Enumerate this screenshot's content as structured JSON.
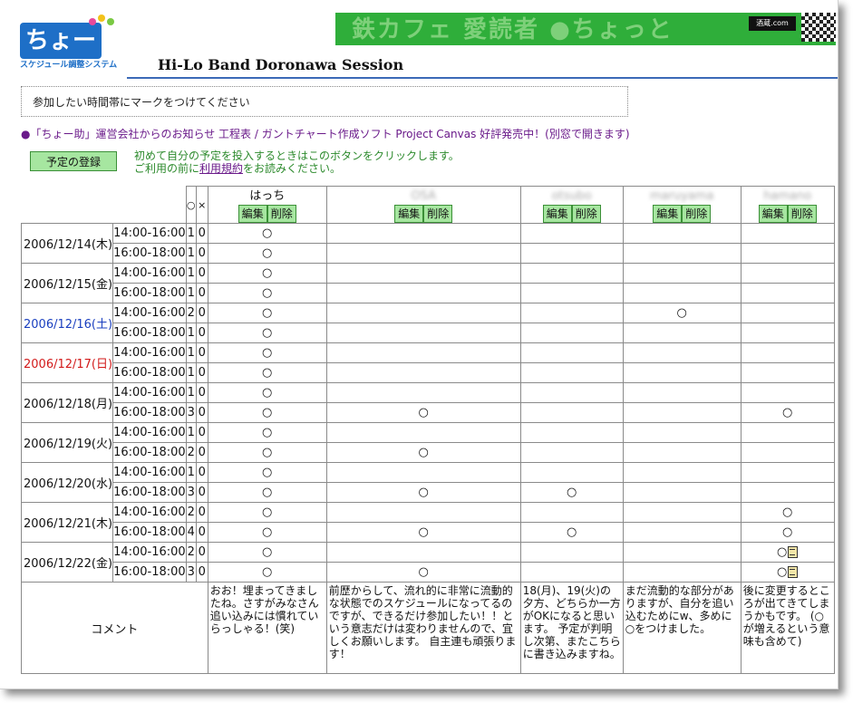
{
  "logo": {
    "main": "ちょー助",
    "sub": "スケジュール調整システム"
  },
  "banner": {
    "text": "鉄カフェ 愛読者 ●ちょっと",
    "badge": "酒蔵.com"
  },
  "title": "Hi-Lo Band Doronawa Session",
  "notice": "参加したい時間帯にマークをつけてください",
  "news": "●「ちょー助」運営会社からのお知らせ 工程表 / ガントチャート作成ソフト Project Canvas 好評発売中！(別窓で開きます)",
  "register": {
    "button": "予定の登録",
    "info_line1": "初めて自分の予定を投入するときはこのボタンをクリックします。",
    "info_line2_pre": "ご利用の前に",
    "info_link": "利用規約",
    "info_line2_post": "をお読みください。"
  },
  "table": {
    "hdr_o": "○",
    "hdr_x": "×",
    "edit_label": "編集",
    "delete_label": "削除",
    "members": [
      "はっち",
      "OSA",
      "otsubo",
      "maruyama",
      "hamano"
    ],
    "comment_label": "コメント",
    "rows": [
      {
        "date": "2006/12/14(木)",
        "day": "wk",
        "time": "14:00-16:00",
        "o": "1",
        "x": "0",
        "marks": [
          "○",
          "",
          "",
          "",
          ""
        ]
      },
      {
        "date": "",
        "day": "wk",
        "time": "16:00-18:00",
        "o": "1",
        "x": "0",
        "marks": [
          "○",
          "",
          "",
          "",
          ""
        ]
      },
      {
        "date": "2006/12/15(金)",
        "day": "wk",
        "time": "14:00-16:00",
        "o": "1",
        "x": "0",
        "marks": [
          "○",
          "",
          "",
          "",
          ""
        ]
      },
      {
        "date": "",
        "day": "wk",
        "time": "16:00-18:00",
        "o": "1",
        "x": "0",
        "marks": [
          "○",
          "",
          "",
          "",
          ""
        ]
      },
      {
        "date": "2006/12/16(土)",
        "day": "sat",
        "time": "14:00-16:00",
        "o": "2",
        "x": "0",
        "marks": [
          "○",
          "",
          "",
          "○",
          ""
        ]
      },
      {
        "date": "",
        "day": "wk",
        "time": "16:00-18:00",
        "o": "1",
        "x": "0",
        "marks": [
          "○",
          "",
          "",
          "",
          ""
        ]
      },
      {
        "date": "2006/12/17(日)",
        "day": "sun",
        "time": "14:00-16:00",
        "o": "1",
        "x": "0",
        "marks": [
          "○",
          "",
          "",
          "",
          ""
        ]
      },
      {
        "date": "",
        "day": "wk",
        "time": "16:00-18:00",
        "o": "1",
        "x": "0",
        "marks": [
          "○",
          "",
          "",
          "",
          ""
        ]
      },
      {
        "date": "2006/12/18(月)",
        "day": "wk",
        "time": "14:00-16:00",
        "o": "1",
        "x": "0",
        "marks": [
          "○",
          "",
          "",
          "",
          ""
        ]
      },
      {
        "date": "",
        "day": "wk",
        "time": "16:00-18:00",
        "o": "3",
        "x": "0",
        "marks": [
          "○",
          "○",
          "",
          "",
          "○"
        ]
      },
      {
        "date": "2006/12/19(火)",
        "day": "wk",
        "time": "14:00-16:00",
        "o": "1",
        "x": "0",
        "marks": [
          "○",
          "",
          "",
          "",
          ""
        ]
      },
      {
        "date": "",
        "day": "wk",
        "time": "16:00-18:00",
        "o": "2",
        "x": "0",
        "marks": [
          "○",
          "○",
          "",
          "",
          ""
        ]
      },
      {
        "date": "2006/12/20(水)",
        "day": "wk",
        "time": "14:00-16:00",
        "o": "1",
        "x": "0",
        "marks": [
          "○",
          "",
          "",
          "",
          ""
        ]
      },
      {
        "date": "",
        "day": "wk",
        "time": "16:00-18:00",
        "o": "3",
        "x": "0",
        "marks": [
          "○",
          "○",
          "○",
          "",
          ""
        ]
      },
      {
        "date": "2006/12/21(木)",
        "day": "wk",
        "time": "14:00-16:00",
        "o": "2",
        "x": "0",
        "marks": [
          "○",
          "",
          "",
          "",
          "○"
        ]
      },
      {
        "date": "",
        "day": "wk",
        "time": "16:00-18:00",
        "o": "4",
        "x": "0",
        "marks": [
          "○",
          "○",
          "○",
          "",
          "○"
        ]
      },
      {
        "date": "2006/12/22(金)",
        "day": "wk",
        "time": "14:00-16:00",
        "o": "2",
        "x": "0",
        "marks": [
          "○",
          "",
          "",
          "",
          "○"
        ],
        "memo": [
          false,
          false,
          false,
          false,
          true
        ]
      },
      {
        "date": "",
        "day": "wk",
        "time": "16:00-18:00",
        "o": "3",
        "x": "0",
        "marks": [
          "○",
          "○",
          "",
          "",
          "○"
        ],
        "memo": [
          false,
          false,
          false,
          false,
          true
        ]
      }
    ],
    "comments": [
      "おお！埋まってきましたね。さすがみなさん追い込みには慣れていらっしゃる！(笑)",
      "前歴からして、流れ的に非常に流動的な状態でのスケジュールになってるのですが、できるだけ参加したい！！という意志だけは変わりませんので、宜しくお願いします。 自主連も頑張ります！",
      "18(月)、19(火)の夕方、どちらか一方がOKになると思います。\n予定が判明し次第、またこちらに書き込みますね。",
      "まだ流動的な部分がありますが、自分を追い込むためにw、多めに○をつけました。",
      "後に変更するところが出てきてしまうかもです。\n(○が増えるという意味も含めて)"
    ]
  },
  "colors": {
    "accent": "#3b6ab7",
    "button": "#a6e6a0",
    "saturday": "#1a3fbf",
    "sunday": "#d21a1a",
    "news": "#6a1a8a",
    "info": "#2c8a2c"
  }
}
